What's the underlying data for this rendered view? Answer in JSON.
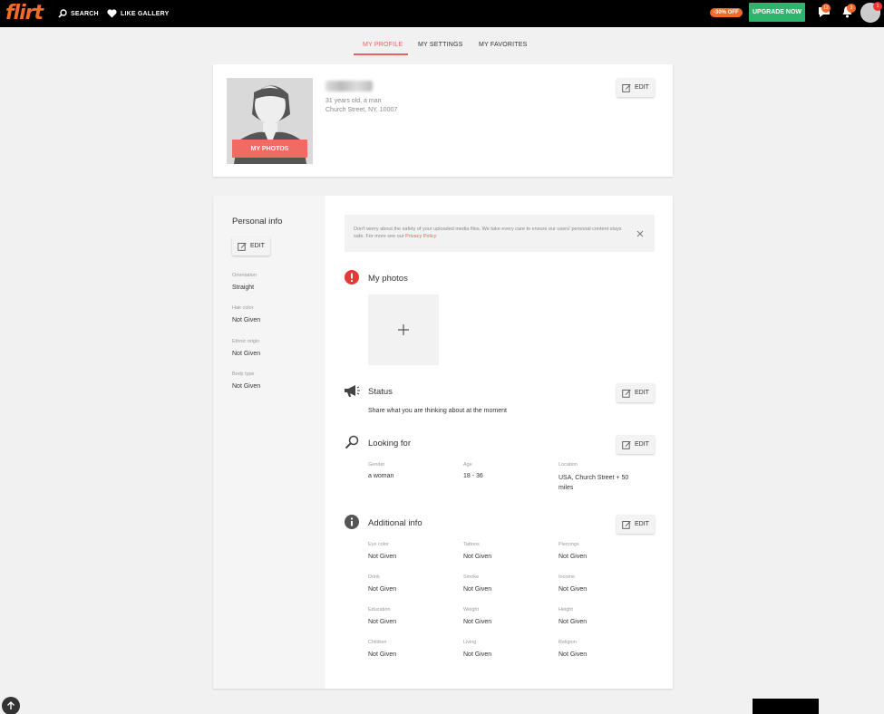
{
  "header": {
    "logo": "flirt",
    "search_label": "SEARCH",
    "like_gallery_label": "LIKE GALLERY",
    "discount_badge": "-30% OFF",
    "upgrade_label": "UPGRADE NOW",
    "messages_count": "12",
    "notifications_count": "3",
    "avatar_count": "1"
  },
  "tabs": [
    {
      "label": "MY PROFILE",
      "active": true
    },
    {
      "label": "MY SETTINGS",
      "active": false
    },
    {
      "label": "MY FAVORITES",
      "active": false
    }
  ],
  "profile": {
    "age_gender": "31 years old, a man",
    "location": "Church Street, NY, 10007",
    "my_photos_label": "MY PHOTOS",
    "edit_label": "EDIT"
  },
  "personal_info": {
    "title": "Personal info",
    "edit_label": "EDIT",
    "fields": [
      {
        "label": "Orientation",
        "value": "Straight"
      },
      {
        "label": "Hair color",
        "value": "Not Given"
      },
      {
        "label": "Ethnic origin",
        "value": "Not Given"
      },
      {
        "label": "Body type",
        "value": "Not Given"
      }
    ]
  },
  "notice": {
    "text": "Don't worry about the safety of your uploaded media files. We take every care to ensure our users' personal content stays safe. For more see our ",
    "link": "Privacy Policy"
  },
  "my_photos": {
    "title": "My photos"
  },
  "status": {
    "title": "Status",
    "edit_label": "EDIT",
    "text": "Share what you are thinking about at the moment"
  },
  "looking_for": {
    "title": "Looking for",
    "edit_label": "EDIT",
    "fields": [
      {
        "label": "Gender",
        "value": "a woman"
      },
      {
        "label": "Age",
        "value": "18 - 36"
      },
      {
        "label": "Location",
        "value": "USA, Church Street + 50 miles"
      }
    ]
  },
  "additional_info": {
    "title": "Additional info",
    "edit_label": "EDIT",
    "fields": [
      {
        "label": "Eye color",
        "value": "Not Given"
      },
      {
        "label": "Tattoos",
        "value": "Not Given"
      },
      {
        "label": "Piercings",
        "value": "Not Given"
      },
      {
        "label": "Drink",
        "value": "Not Given"
      },
      {
        "label": "Smoke",
        "value": "Not Given"
      },
      {
        "label": "Income",
        "value": "Not Given"
      },
      {
        "label": "Education",
        "value": "Not Given"
      },
      {
        "label": "Weight",
        "value": "Not Given"
      },
      {
        "label": "Height",
        "value": "Not Given"
      },
      {
        "label": "Children",
        "value": "Not Given"
      },
      {
        "label": "Living",
        "value": "Not Given"
      },
      {
        "label": "Religion",
        "value": "Not Given"
      }
    ]
  },
  "colors": {
    "accent": "#e8635d",
    "brand_orange": "#f26b2a",
    "upgrade_green": "#2fb46e",
    "alert_red": "#e53935"
  }
}
